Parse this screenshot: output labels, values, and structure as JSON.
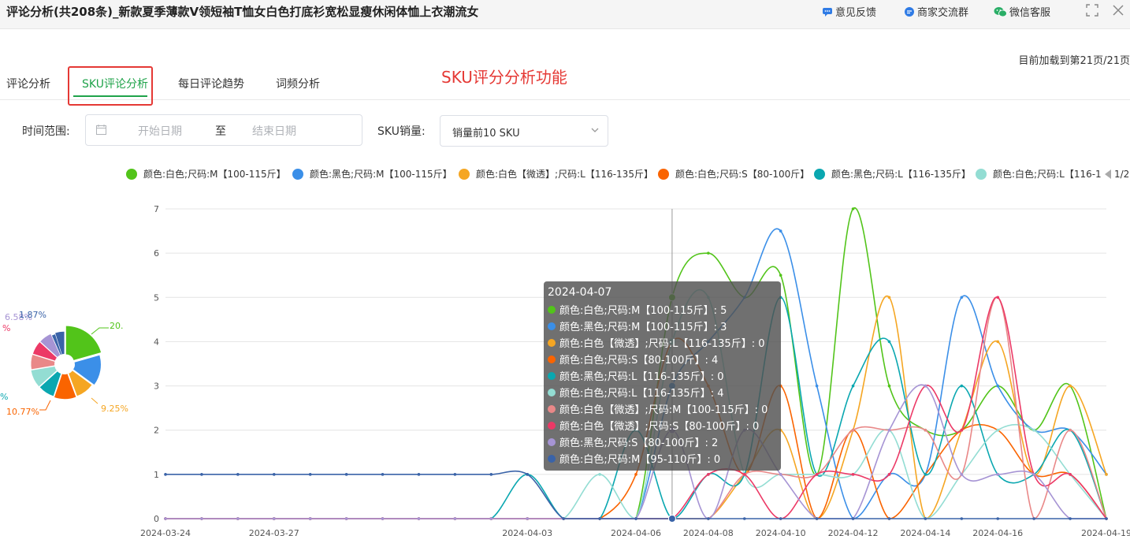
{
  "window": {
    "title": "评论分析(共208条)_新款夏季薄款V领短袖T恤女白色打底衫宽松显瘦休闲体恤上衣潮流女",
    "feedback": "意见反馈",
    "merchant_group": "商家交流群",
    "wechat_service": "微信客服"
  },
  "status": "目前加载到第21页/21页",
  "tabs": [
    {
      "label": "评论分析"
    },
    {
      "label": "SKU评论分析"
    },
    {
      "label": "每日评论趋势"
    },
    {
      "label": "词频分析"
    }
  ],
  "feature_label": "SKU评分分析功能",
  "filters": {
    "time_range_label": "时间范围:",
    "start_placeholder": "开始日期",
    "separator": "至",
    "end_placeholder": "结束日期",
    "sku_label": "SKU销量:",
    "sku_value": "销量前10 SKU"
  },
  "legend_visible": [
    "颜色:白色;尺码:M【100-115斤】",
    "颜色:黑色;尺码:M【100-115斤】",
    "颜色:白色【微透】;尺码:L【116-135斤】",
    "颜色:白色;尺码:S【80-100斤】",
    "颜色:黑色;尺码:L【116-135斤】",
    "颜色:白色;尺码:L【116-1"
  ],
  "legend_pager": "1/2",
  "colors": [
    "#52c41a",
    "#3b8fe8",
    "#f5a623",
    "#fa6400",
    "#0aa7b0",
    "#93ddd3",
    "#e98888",
    "#ec3966",
    "#a694d4",
    "#3a63a8"
  ],
  "chart_data": [
    {
      "type": "line",
      "x": [
        "2024-03-24",
        "2024-03-25",
        "2024-03-26",
        "2024-03-27",
        "2024-03-28",
        "2024-03-29",
        "2024-03-30",
        "2024-03-31",
        "2024-04-01",
        "2024-04-02",
        "2024-04-03",
        "2024-04-04",
        "2024-04-05",
        "2024-04-06",
        "2024-04-07",
        "2024-04-08",
        "2024-04-09",
        "2024-04-10",
        "2024-04-11",
        "2024-04-12",
        "2024-04-13",
        "2024-04-14",
        "2024-04-15",
        "2024-04-16",
        "2024-04-17",
        "2024-04-18",
        "2024-04-19"
      ],
      "x_tick_labels": [
        "2024-03-24",
        "2024-03-27",
        "2024-04-03",
        "2024-04-06",
        "2024-04-08",
        "2024-04-10",
        "2024-04-12",
        "2024-04-14",
        "2024-04-16",
        "2024-04-19"
      ],
      "ylim": [
        0,
        7
      ],
      "y_ticks": [
        0,
        1,
        2,
        3,
        4,
        5,
        6,
        7
      ],
      "grid": true,
      "series": [
        {
          "name": "颜色:白色;尺码:M【100-115斤】",
          "values": [
            0,
            0,
            0,
            0,
            0,
            0,
            0,
            0,
            0,
            0,
            0,
            0,
            0,
            0,
            5,
            6,
            5,
            5.5,
            1,
            7,
            3,
            2,
            2,
            3,
            2,
            3,
            0
          ]
        },
        {
          "name": "颜色:黑色;尺码:M【100-115斤】",
          "values": [
            0,
            0,
            0,
            0,
            0,
            0,
            0,
            0,
            0,
            0,
            0,
            0,
            0,
            0,
            3,
            4,
            5,
            6.5,
            3,
            0,
            1,
            1,
            5,
            3,
            2,
            2,
            1
          ]
        },
        {
          "name": "颜色:白色【微透】;尺码:L【116-135斤】",
          "values": [
            0,
            0,
            0,
            0,
            0,
            0,
            0,
            0,
            0,
            0,
            0,
            0,
            0,
            0,
            0,
            0,
            1,
            2,
            0,
            2,
            5,
            0,
            2,
            4,
            1,
            3,
            1
          ]
        },
        {
          "name": "颜色:白色;尺码:S【80-100斤】",
          "values": [
            0,
            0,
            0,
            0,
            0,
            0,
            0,
            0,
            0,
            0,
            0,
            0,
            0,
            1,
            4,
            3,
            1,
            3,
            0,
            2,
            0,
            1,
            2,
            2,
            1,
            1,
            0
          ]
        },
        {
          "name": "颜色:黑色;尺码:L【116-135斤】",
          "values": [
            0,
            0,
            0,
            0,
            0,
            0,
            0,
            0,
            0,
            0,
            1,
            0,
            0,
            2,
            0,
            1,
            1,
            5,
            1,
            3,
            4,
            1,
            3,
            1,
            1,
            2,
            0
          ]
        },
        {
          "name": "颜色:白色;尺码:L【116-135斤】",
          "values": [
            0,
            0,
            0,
            0,
            0,
            0,
            0,
            0,
            0,
            0,
            0,
            0,
            1,
            0,
            4,
            5,
            1,
            1,
            1,
            1,
            2,
            0,
            1,
            2,
            2,
            1,
            0
          ]
        },
        {
          "name": "颜色:白色【微透】;尺码:M【100-115斤】",
          "values": [
            0,
            0,
            0,
            0,
            0,
            0,
            0,
            0,
            0,
            0,
            0,
            0,
            0,
            0,
            0,
            0,
            1,
            1,
            1,
            2,
            2,
            2,
            1,
            5,
            0,
            2,
            0
          ]
        },
        {
          "name": "颜色:白色【微透】;尺码:S【80-100斤】",
          "values": [
            0,
            0,
            0,
            0,
            0,
            0,
            0,
            0,
            0,
            0,
            0,
            0,
            0,
            0,
            0,
            1,
            1,
            0,
            1,
            1,
            1,
            3,
            2,
            5,
            1,
            1,
            0
          ]
        },
        {
          "name": "颜色:黑色;尺码:S【80-100斤】",
          "values": [
            0,
            0,
            0,
            0,
            0,
            0,
            0,
            0,
            0,
            0,
            0,
            0,
            0,
            0,
            2,
            0,
            2,
            1,
            0,
            0,
            2,
            3,
            1,
            1,
            1,
            0,
            0
          ]
        },
        {
          "name": "颜色:白色;尺码:M【95-110斤】",
          "values": [
            1,
            1,
            1,
            1,
            1,
            1,
            1,
            1,
            1,
            1,
            1,
            0,
            0,
            0,
            0,
            0,
            0,
            0,
            0,
            0,
            0,
            0,
            0,
            0,
            0,
            0,
            0
          ]
        }
      ]
    },
    {
      "type": "pie",
      "visible_labels": [
        "20.",
        "9.25%",
        "10.77%",
        "6.58%",
        "1.87%",
        "%",
        "%"
      ],
      "slices": [
        20.6,
        14.5,
        9.25,
        10.77,
        8.2,
        9.0,
        7.5,
        6.9,
        6.58,
        1.87,
        4.83
      ]
    }
  ],
  "tooltip": {
    "title": "2024-04-07",
    "rows": [
      "颜色:白色;尺码:M【100-115斤】: 5",
      "颜色:黑色;尺码:M【100-115斤】: 3",
      "颜色:白色【微透】;尺码:L【116-135斤】: 0",
      "颜色:白色;尺码:S【80-100斤】: 4",
      "颜色:黑色;尺码:L【116-135斤】: 0",
      "颜色:白色;尺码:L【116-135斤】: 4",
      "颜色:白色【微透】;尺码:M【100-115斤】: 0",
      "颜色:白色【微透】;尺码:S【80-100斤】: 0",
      "颜色:黑色;尺码:S【80-100斤】: 2",
      "颜色:白色;尺码:M【95-110斤】: 0"
    ]
  }
}
